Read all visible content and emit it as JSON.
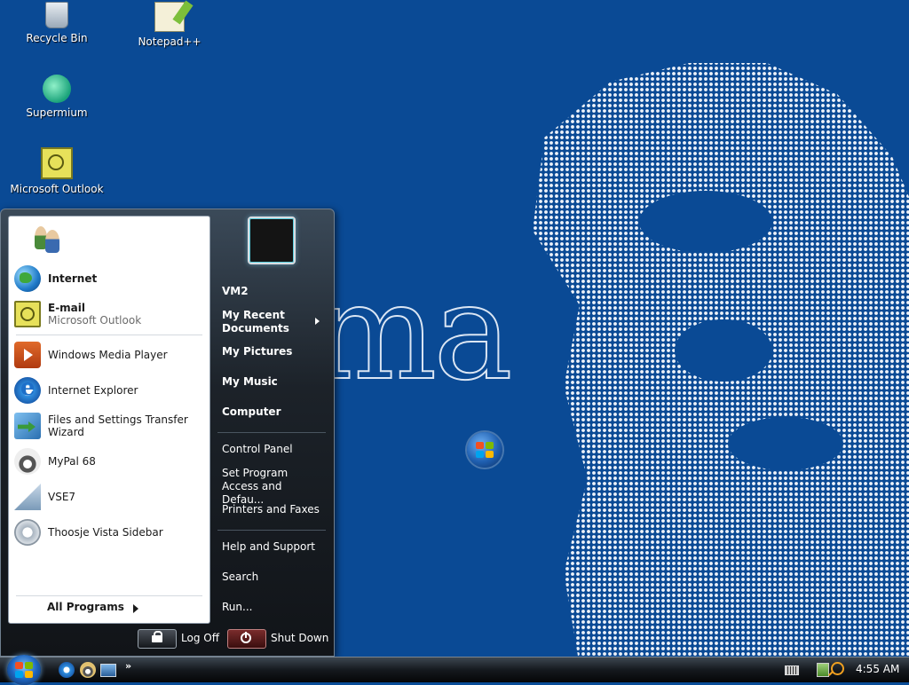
{
  "desktop": {
    "icons": [
      {
        "label": "Recycle Bin",
        "icon": "recycle-bin-icon"
      },
      {
        "label": "Notepad++",
        "icon": "notepadpp-icon"
      },
      {
        "label": "Supermium",
        "icon": "supermium-icon"
      },
      {
        "label": "Microsoft Outlook",
        "icon": "outlook-icon"
      }
    ],
    "wallpaper_text": "ma",
    "colors": {
      "background": "#0a4a95",
      "halftone": "#eef3fa"
    }
  },
  "start_menu": {
    "pinned": [
      {
        "label": "Internet",
        "icon": "globe-icon"
      },
      {
        "label": "E-mail",
        "sub": "Microsoft Outlook",
        "icon": "email-icon"
      }
    ],
    "recent": [
      {
        "label": "Windows Media Player",
        "icon": "media-player-icon"
      },
      {
        "label": "Internet Explorer",
        "icon": "internet-explorer-icon"
      },
      {
        "label": "Files and Settings Transfer Wizard",
        "icon": "transfer-wizard-icon"
      },
      {
        "label": "MyPal 68",
        "icon": "mypal-icon"
      },
      {
        "label": "VSE7",
        "icon": "vse7-icon"
      },
      {
        "label": "Thoosje Vista Sidebar",
        "icon": "gear-icon"
      }
    ],
    "all_programs": "All Programs",
    "right": {
      "user": "VM2",
      "recent_documents": "My Recent Documents",
      "pictures": "My Pictures",
      "music": "My Music",
      "computer": "Computer",
      "control_panel": "Control Panel",
      "set_program_access": "Set Program Access and Defau...",
      "printers": "Printers and Faxes",
      "help": "Help and Support",
      "search": "Search",
      "run": "Run..."
    },
    "log_off": "Log Off",
    "shut_down": "Shut Down"
  },
  "taskbar": {
    "quick_launch": [
      "internet-explorer-icon",
      "mypal-icon",
      "show-desktop-icon"
    ],
    "more": "»",
    "clock": "4:55 AM"
  }
}
